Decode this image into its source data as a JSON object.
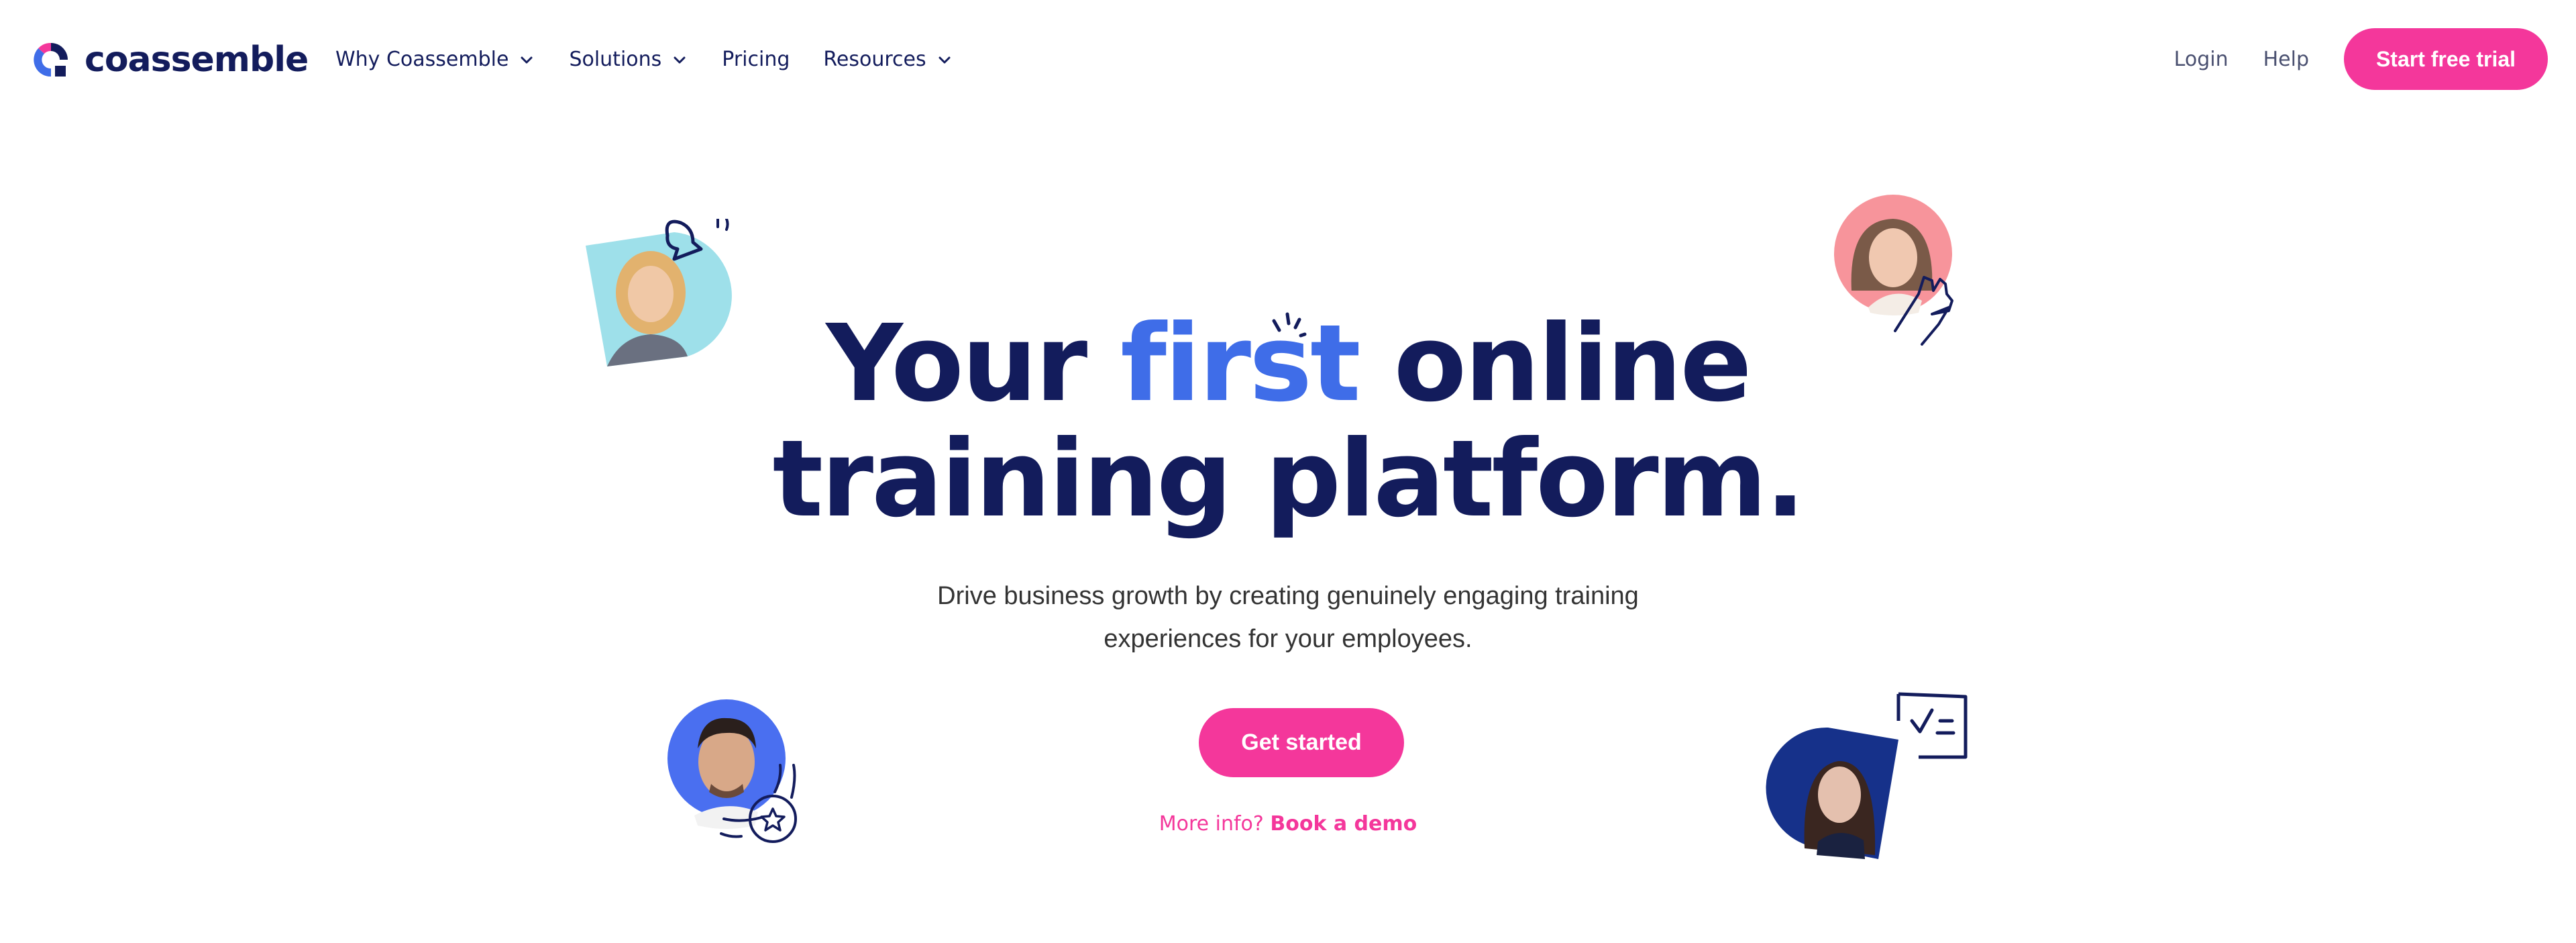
{
  "brand": {
    "name": "coassemble",
    "colors": {
      "navy": "#131c5c",
      "blue": "#3f6de8",
      "pink": "#f4379b",
      "cyan": "#9ee0ea",
      "salmon": "#f7949b",
      "royal": "#16318a"
    }
  },
  "header": {
    "nav": [
      {
        "label": "Why Coassemble",
        "has_dropdown": true,
        "icon": "chevron-down-icon"
      },
      {
        "label": "Solutions",
        "has_dropdown": true,
        "icon": "chevron-down-icon"
      },
      {
        "label": "Pricing",
        "has_dropdown": false
      },
      {
        "label": "Resources",
        "has_dropdown": true,
        "icon": "chevron-down-icon"
      }
    ],
    "login_label": "Login",
    "help_label": "Help",
    "trial_label": "Start free trial"
  },
  "hero": {
    "headline_before": "Your ",
    "headline_accent": "first",
    "headline_after": " online",
    "headline_line2": "training platform.",
    "subtitle_line1": "Drive business growth by creating genuinely engaging training",
    "subtitle_line2": "experiences for your employees.",
    "cta_label": "Get started",
    "more_info_label": "More info?",
    "demo_label": "Book a demo"
  },
  "decorations": [
    {
      "name": "avatar-top-left",
      "icon": "bell-icon"
    },
    {
      "name": "avatar-top-right",
      "icon": "hand-wave-icon"
    },
    {
      "name": "avatar-bottom-left",
      "icon": "star-badge-icon"
    },
    {
      "name": "avatar-bottom-right",
      "icon": "checklist-icon"
    }
  ]
}
